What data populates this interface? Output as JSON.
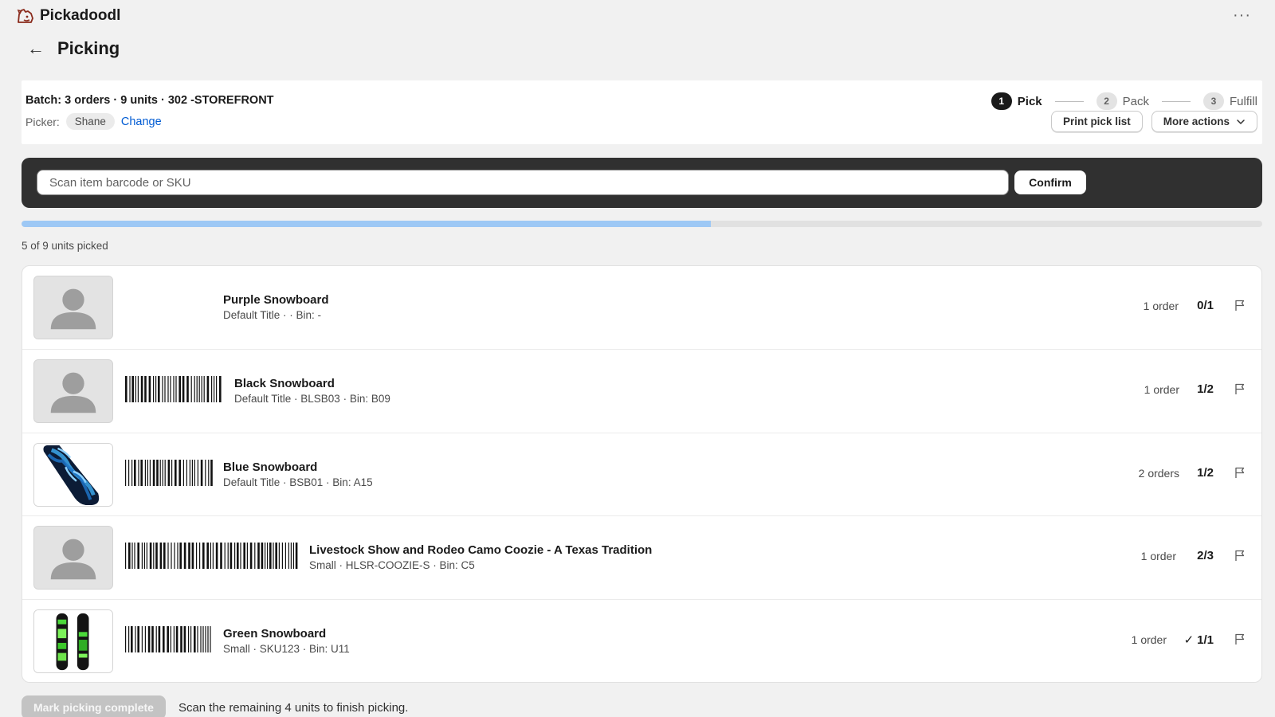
{
  "app": {
    "name": "Pickadoodl",
    "menu_icon": "ellipsis-icon"
  },
  "page": {
    "title": "Picking"
  },
  "batch": {
    "summary": "Batch: 3 orders · 9 units · 302 -STOREFRONT",
    "picker_label": "Picker:",
    "picker_name": "Shane",
    "change_label": "Change"
  },
  "steps": [
    {
      "num": "1",
      "label": "Pick",
      "state": "active"
    },
    {
      "num": "2",
      "label": "Pack",
      "state": "inactive"
    },
    {
      "num": "3",
      "label": "Fulfill",
      "state": "inactive"
    }
  ],
  "actions": {
    "print_label": "Print pick list",
    "more_label": "More actions"
  },
  "scan": {
    "placeholder": "Scan item barcode or SKU",
    "confirm_label": "Confirm"
  },
  "progress": {
    "picked": 5,
    "total": 9,
    "fraction": 0.5556,
    "text": "5 of 9 units picked"
  },
  "items": [
    {
      "name": "Purple Snowboard",
      "meta": "Default Title · · Bin: -",
      "orders": "1 order",
      "qty": "0/1",
      "done": false,
      "thumb": "placeholder",
      "barcode": false
    },
    {
      "name": "Black Snowboard",
      "meta": "Default Title · BLSB03 · Bin: B09",
      "orders": "1 order",
      "qty": "1/2",
      "done": false,
      "thumb": "placeholder",
      "barcode": true
    },
    {
      "name": "Blue Snowboard",
      "meta": "Default Title · BSB01 · Bin: A15",
      "orders": "2 orders",
      "qty": "1/2",
      "done": false,
      "thumb": "blue-board",
      "barcode": true
    },
    {
      "name": "Livestock Show and Rodeo Camo Coozie - A Texas Tradition",
      "meta": "Small · HLSR-COOZIE-S · Bin: C5",
      "orders": "1 order",
      "qty": "2/3",
      "done": false,
      "thumb": "placeholder",
      "barcode": true
    },
    {
      "name": "Green Snowboard",
      "meta": "Small · SKU123 · Bin: U11",
      "orders": "1 order",
      "qty": "1/1",
      "done": true,
      "thumb": "green-board",
      "barcode": true
    }
  ],
  "footer": {
    "complete_label": "Mark picking complete",
    "message": "Scan the remaining 4 units to finish picking."
  },
  "colors": {
    "accent": "#005bd3",
    "progress": "#9dc8f5",
    "scan_bg": "#303030",
    "text": "#303030"
  }
}
